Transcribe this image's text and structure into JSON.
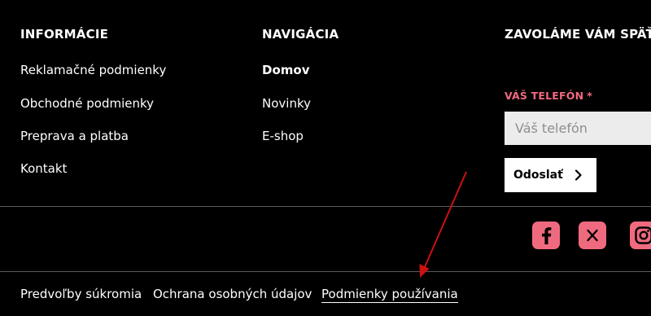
{
  "info": {
    "title": "INFORMÁCIE",
    "links": [
      "Reklamačné podmienky",
      "Obchodné podmienky",
      "Preprava a platba",
      "Kontakt"
    ]
  },
  "nav": {
    "title": "NAVIGÁCIA",
    "links": [
      "Domov",
      "Novinky",
      "E-shop"
    ]
  },
  "callback": {
    "title": "ZAVOLÁME VÁM SPÄŤ",
    "phone_label": "VÁŠ TELEFÓN",
    "required_mark": "*",
    "phone_placeholder": "Váš telefón",
    "send_label": "Odoslať"
  },
  "social": {
    "icons": [
      "facebook-icon",
      "x-icon",
      "instagram-icon"
    ]
  },
  "bottom": {
    "links": [
      "Predvoľby súkromia",
      "Ochrana osobných údajov",
      "Podmienky používania"
    ]
  },
  "colors": {
    "accent": "#f06a7f",
    "annotation_arrow": "#cc1111"
  }
}
